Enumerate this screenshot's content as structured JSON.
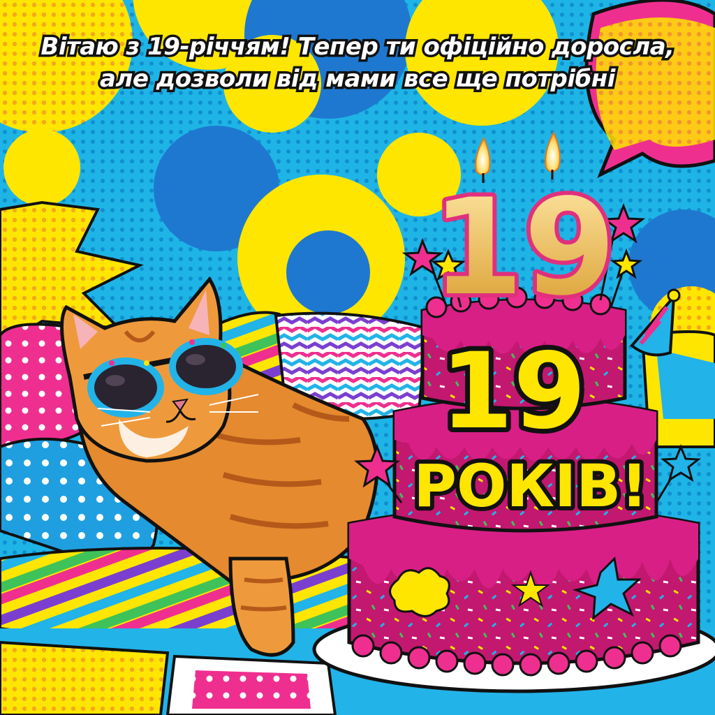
{
  "greeting": {
    "line1": "Вітаю з 19-річчям! Тепер ти офіційно доросла,",
    "line2": "але дозволи від мами все ще потрібні"
  },
  "candles": {
    "digits": "19"
  },
  "cake": {
    "number": "19",
    "word": "РОКІВ!"
  },
  "colors": {
    "background": "#1fb4e6",
    "yellow": "#ffe600",
    "blue": "#1e78d0",
    "magenta": "#d1157a",
    "cake_pink": "#c2186f",
    "cat_orange": "#e58a2e",
    "gold": "#f3c84a"
  },
  "icons": [
    "cat-with-sunglasses",
    "birthday-cake",
    "candle-flame",
    "star",
    "party-hat",
    "speech-bubble"
  ]
}
